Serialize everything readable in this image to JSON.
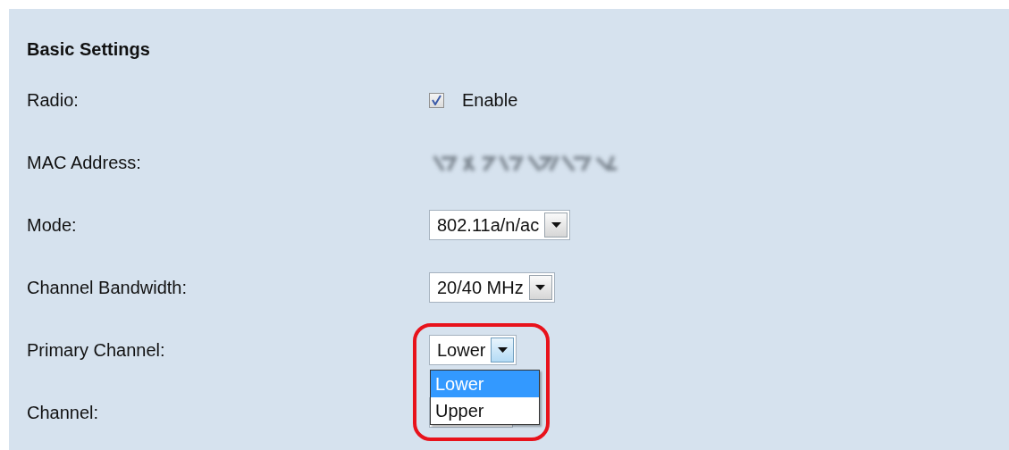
{
  "section": {
    "title": "Basic Settings"
  },
  "rows": [
    {
      "label": "Radio:",
      "kind": "checkbox",
      "checked": true,
      "text": "Enable"
    },
    {
      "label": "MAC Address:",
      "kind": "redacted"
    },
    {
      "label": "Mode:",
      "kind": "select",
      "value": "802.11a/n/ac",
      "focused": false
    },
    {
      "label": "Channel Bandwidth:",
      "kind": "select",
      "value": "20/40 MHz",
      "focused": false
    },
    {
      "label": "Primary Channel:",
      "kind": "select",
      "value": "Lower",
      "focused": true,
      "highlighted": true,
      "options": [
        {
          "label": "Lower",
          "selected": true
        },
        {
          "label": "Upper",
          "selected": false
        }
      ]
    },
    {
      "label": "Channel:",
      "kind": "select"
    }
  ]
}
